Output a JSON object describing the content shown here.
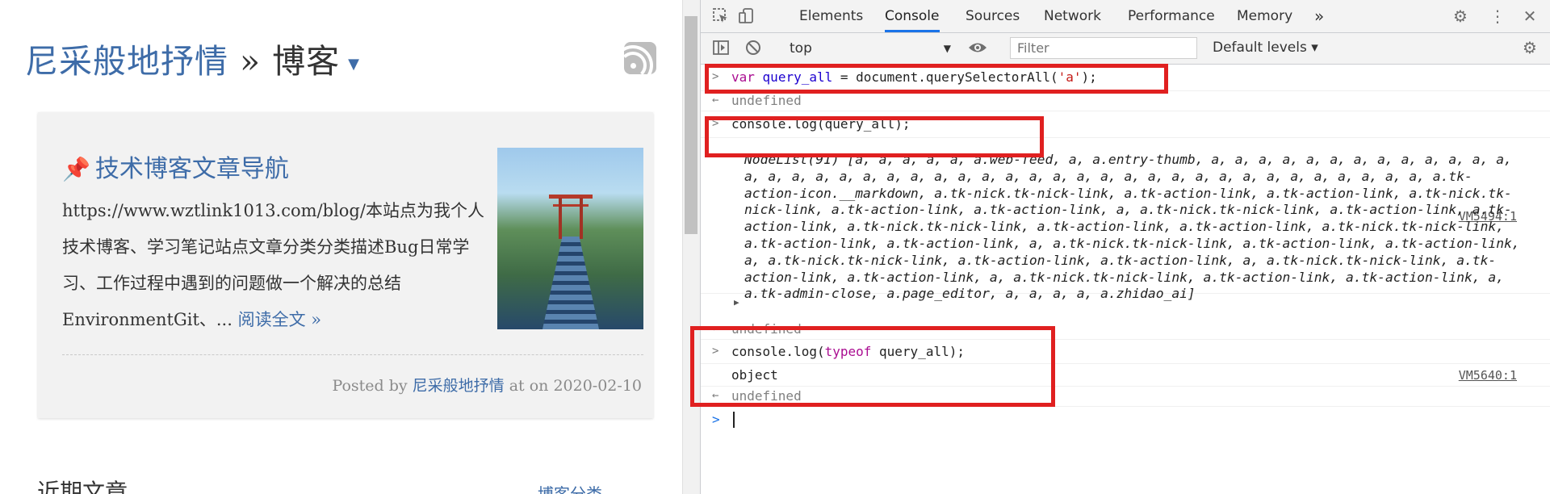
{
  "blog": {
    "site": "尼采般地抒情",
    "sep": " » ",
    "section": "博客",
    "caret": "▼"
  },
  "post": {
    "title": "技术博客文章导航",
    "excerpt": "https://www.wztlink1013.com/blog/本站点为我个人技术博客、学习笔记站点文章分类分类描述Bug日常学习、工作过程中遇到的问题做一个解决的总结EnvironmentGit、...",
    "read_more": "阅读全文 »",
    "meta_prefix": "Posted by ",
    "author": "尼采般地抒情",
    "meta_suffix": " at on 2020-02-10"
  },
  "sidebar": {
    "recent": "近期文章",
    "categories": "博客分类"
  },
  "devtools": {
    "tabs": [
      "Elements",
      "Console",
      "Sources",
      "Network",
      "Performance",
      "Memory"
    ],
    "active_tab": "Console",
    "more_tabs": "»",
    "context": "top",
    "filter_placeholder": "Filter",
    "levels": "Default levels ▾",
    "icons": [
      "inspect-icon",
      "device-toggle-icon",
      "settings-icon",
      "more-vert-icon",
      "close-icon",
      "sidebar-toggle-icon",
      "clear-console-icon",
      "eye-icon"
    ]
  },
  "console": {
    "line1": "var query_all = document.querySelectorAll('a');",
    "undefined": "undefined",
    "line2": "console.log(query_all);",
    "src1": "VM5494:1",
    "nodelist": "NodeList(91) [a, a, a, a, a, a.web-feed, a, a.entry-thumb, a, a, a, a, a, a, a, a, a, a, a, a, a, a, a, a, a, a, a, a, a, a, a, a, a, a, a, a, a, a, a, a, a, a, a, a, a, a, a, a, a, a, a.tk-action-icon.__markdown, a.tk-nick.tk-nick-link, a.tk-action-link, a.tk-action-link, a.tk-nick.tk-nick-link, a.tk-action-link, a.tk-action-link, a, a.tk-nick.tk-nick-link, a.tk-action-link, a.tk-action-link, a.tk-nick.tk-nick-link, a.tk-action-link, a.tk-action-link, a.tk-nick.tk-nick-link, a.tk-action-link, a.tk-action-link, a, a.tk-nick.tk-nick-link, a.tk-action-link, a.tk-action-link, a, a.tk-nick.tk-nick-link, a.tk-action-link, a.tk-action-link, a, a.tk-nick.tk-nick-link, a.tk-action-link, a.tk-action-link, a, a.tk-nick.tk-nick-link, a.tk-action-link, a.tk-action-link, a, a.tk-admin-close, a.page_editor, a, a, a, a, a.zhidao_ai]",
    "line3_kw": "typeof",
    "line3": "console.log(typeof query_all);",
    "object": "object",
    "src2": "VM5640:1"
  }
}
